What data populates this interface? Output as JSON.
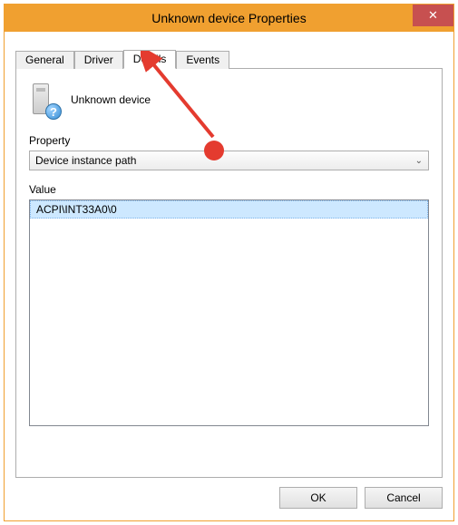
{
  "window": {
    "title": "Unknown device Properties"
  },
  "tabs": [
    {
      "label": "General"
    },
    {
      "label": "Driver"
    },
    {
      "label": "Details"
    },
    {
      "label": "Events"
    }
  ],
  "active_tab_index": 2,
  "device": {
    "name": "Unknown device"
  },
  "property": {
    "label": "Property",
    "selected": "Device instance path"
  },
  "value": {
    "label": "Value",
    "items": [
      "ACPI\\INT33A0\\0"
    ],
    "selected_index": 0
  },
  "buttons": {
    "ok": "OK",
    "cancel": "Cancel"
  },
  "annotation": {
    "color": "#e43b2f"
  }
}
